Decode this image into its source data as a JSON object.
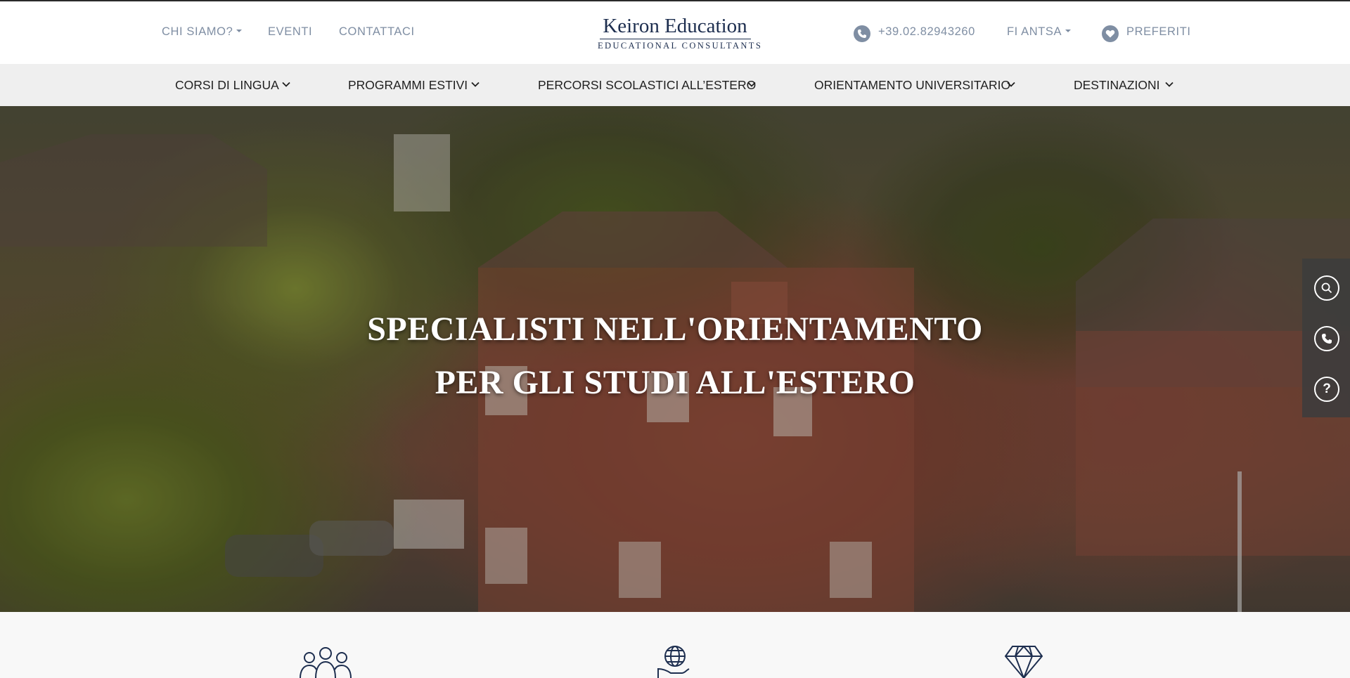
{
  "top_nav": {
    "chi_siamo": "CHI SIAMO?",
    "eventi": "EVENTI",
    "contattaci": "CONTATTACI",
    "phone": "+39.02.82943260",
    "fi_antsa": "FI ANTSA",
    "preferiti": "PREFERITI"
  },
  "logo": {
    "title": "Keiron Education",
    "subtitle": "EDUCATIONAL CONSULTANTS"
  },
  "main_nav": {
    "items": [
      {
        "label": "CORSI DI LINGUA"
      },
      {
        "label": "PROGRAMMI ESTIVI"
      },
      {
        "label": "PERCORSI SCOLASTICI ALL’ESTERO"
      },
      {
        "label": "ORIENTAMENTO UNIVERSITARIO"
      },
      {
        "label": "DESTINAZIONI"
      }
    ]
  },
  "hero": {
    "line1": "SPECIALISTI NELL'ORIENTAMENTO",
    "line2": "PER GLI STUDI ALL'ESTERO"
  },
  "side_tools": {
    "search": "search-icon",
    "phone": "phone-icon",
    "help": "?"
  },
  "colors": {
    "nav_text": "#7f8ea3",
    "brand_navy": "#1d2e4f",
    "nav_bg": "#efefef"
  }
}
